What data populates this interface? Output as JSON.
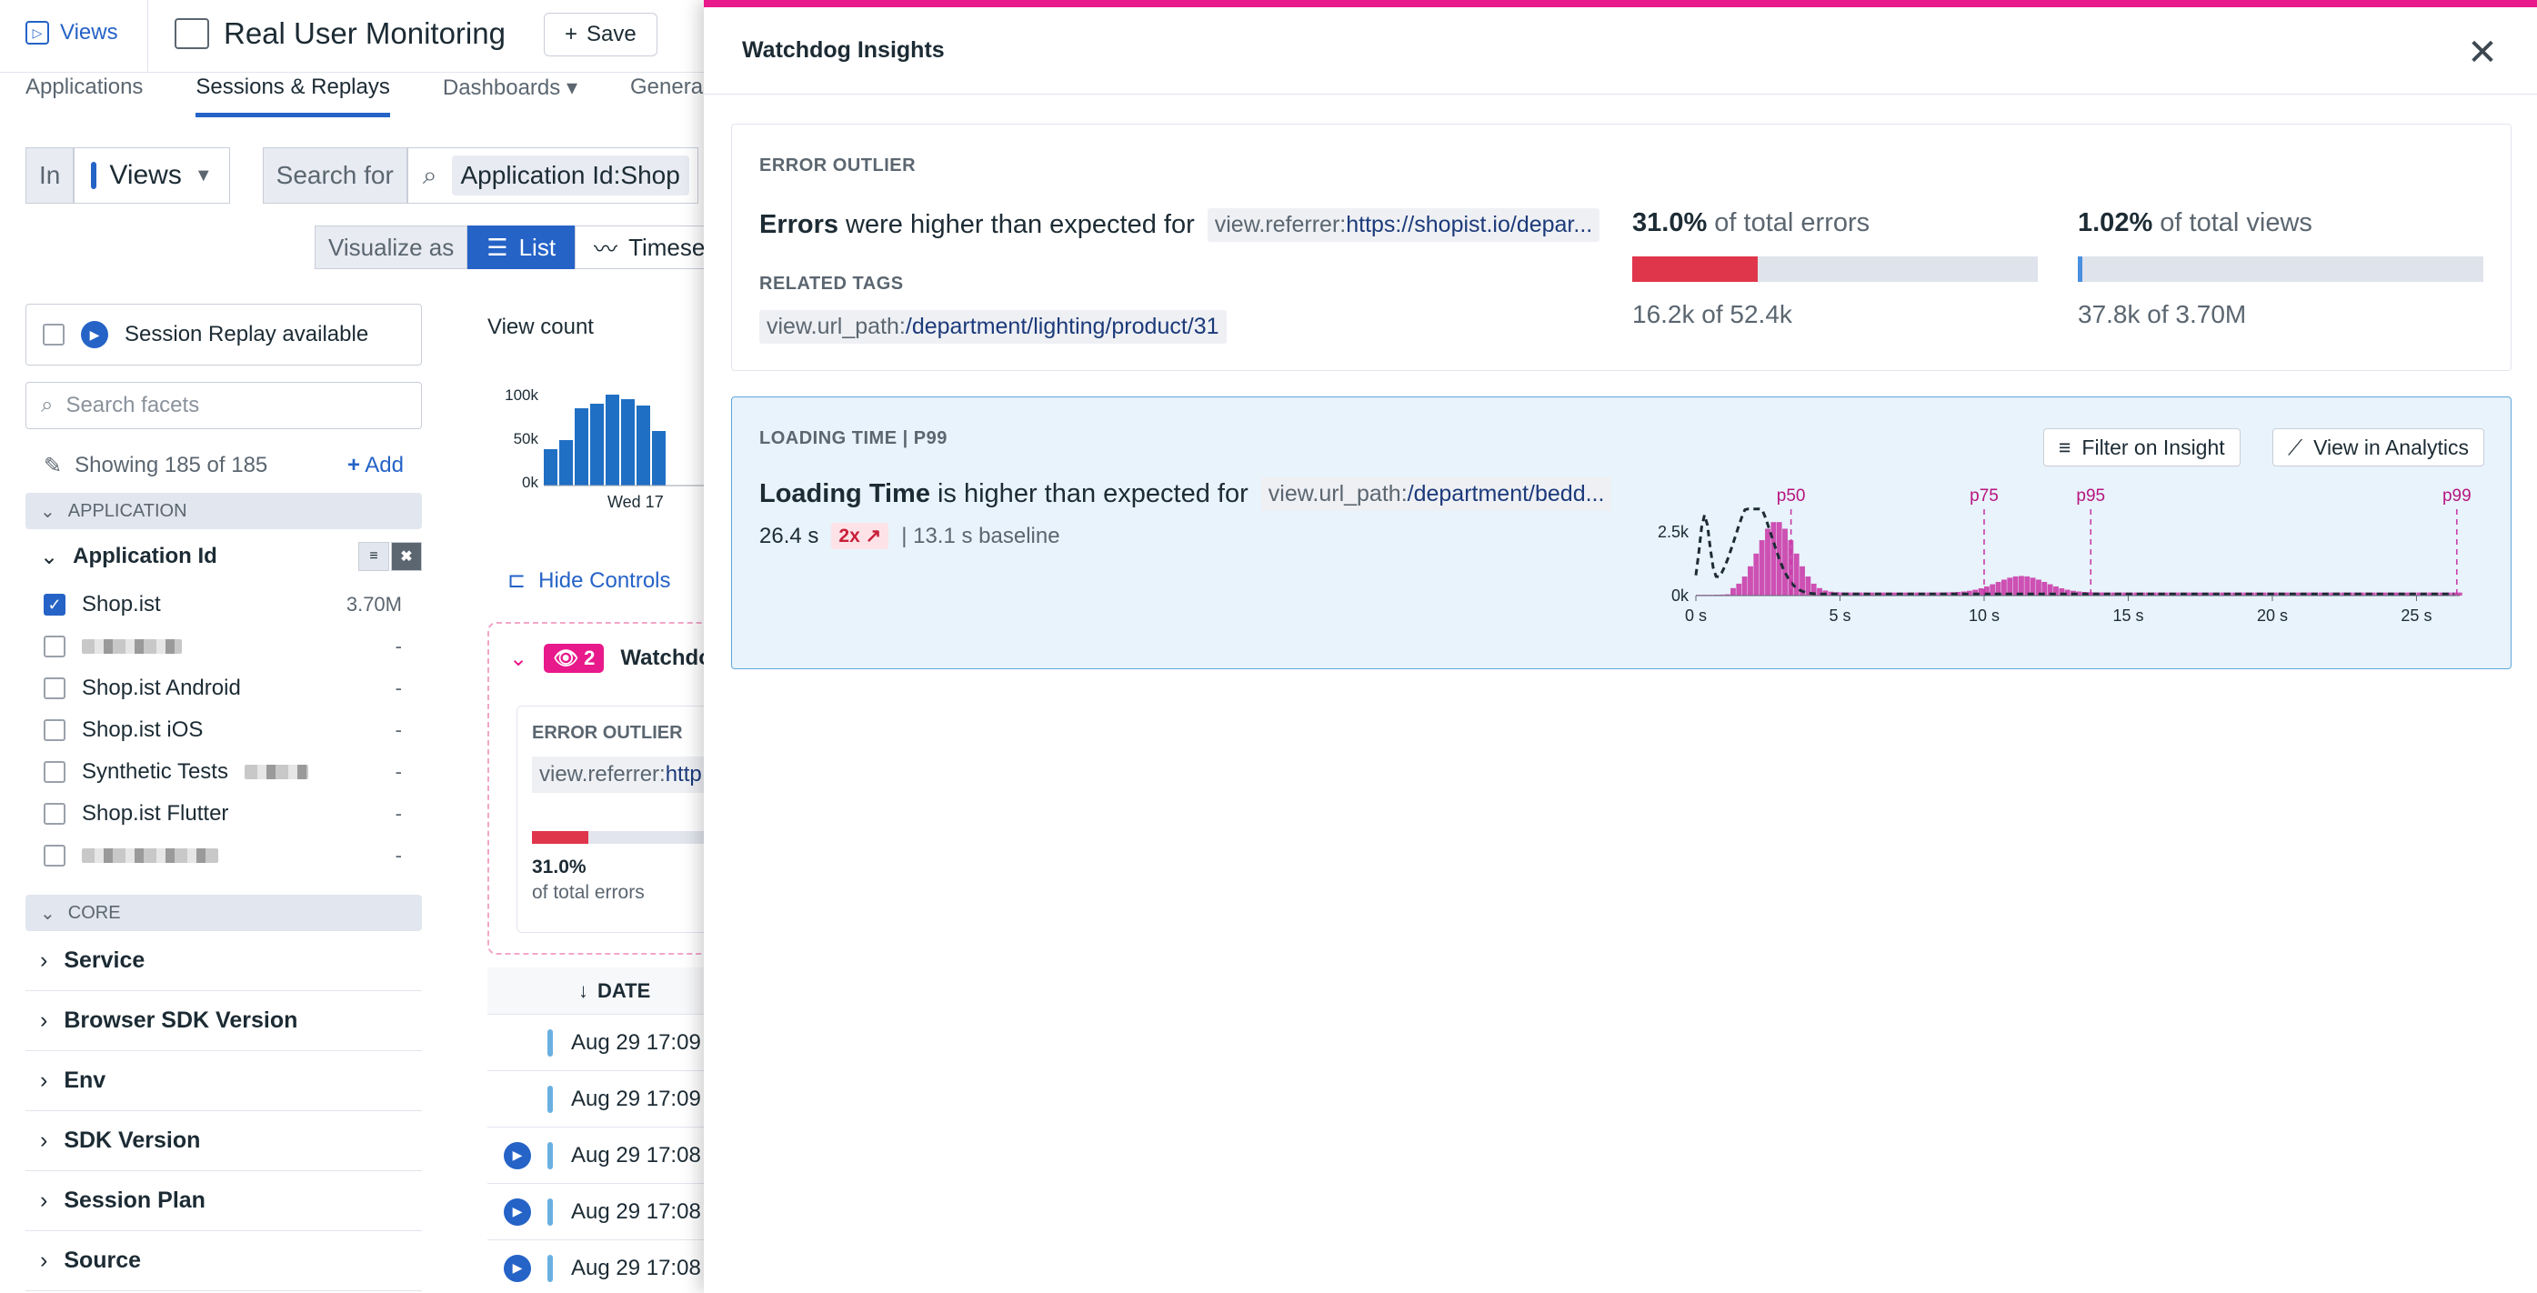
{
  "topbar": {
    "views_label": "Views",
    "page_title": "Real User Monitoring",
    "save_label": "Save"
  },
  "nav": {
    "tabs": [
      {
        "label": "Applications",
        "active": false
      },
      {
        "label": "Sessions & Replays",
        "active": true
      },
      {
        "label": "Dashboards",
        "active": false
      },
      {
        "label": "Genera",
        "active": false
      }
    ]
  },
  "query": {
    "in_label": "In",
    "scope_value": "Views",
    "search_for_label": "Search for",
    "search_value": "Application Id:Shop",
    "visualize_as_label": "Visualize as",
    "viz_list": "List",
    "viz_timeseries": "Timeseri"
  },
  "facets": {
    "session_replay_label": "Session Replay available",
    "search_placeholder": "Search facets",
    "showing_text": "Showing 185 of 185",
    "add_label": "Add",
    "application_section": "APPLICATION",
    "application_id_title": "Application Id",
    "app_items": [
      {
        "label": "Shop.ist",
        "count": "3.70M",
        "checked": true,
        "blurred": false
      },
      {
        "label": "",
        "count": "-",
        "checked": false,
        "blurred": true
      },
      {
        "label": "Shop.ist Android",
        "count": "-",
        "checked": false,
        "blurred": false
      },
      {
        "label": "Shop.ist iOS",
        "count": "-",
        "checked": false,
        "blurred": false
      },
      {
        "label": "Synthetic Tests",
        "count": "-",
        "checked": false,
        "blurred": "partial"
      },
      {
        "label": "Shop.ist Flutter",
        "count": "-",
        "checked": false,
        "blurred": false
      },
      {
        "label": "",
        "count": "-",
        "checked": false,
        "blurred": true
      }
    ],
    "core_section": "CORE",
    "core_items": [
      "Service",
      "Browser SDK Version",
      "Env",
      "SDK Version",
      "Session Plan",
      "Source"
    ]
  },
  "middle": {
    "view_count_label": "View count",
    "histogram": {
      "y_ticks": [
        "100k",
        "50k",
        "0k"
      ],
      "x_label": "Wed 17",
      "bars": [
        40,
        50,
        85,
        90,
        100,
        95,
        88,
        60
      ]
    },
    "hide_controls_label": "Hide Controls",
    "watchdog_badge": "2",
    "watchdog_title": "Watchdo",
    "card_kicker": "ERROR OUTLIER",
    "card_tag_key": "view.referrer:",
    "card_tag_value": "http",
    "card_progress": 0.31,
    "card_pct": "31.0%",
    "card_sub": "of total errors",
    "date_header": "DATE",
    "rows": [
      {
        "date": "Aug 29 17:09",
        "replay": false
      },
      {
        "date": "Aug 29 17:09",
        "replay": false
      },
      {
        "date": "Aug 29 17:08",
        "replay": true
      },
      {
        "date": "Aug 29 17:08",
        "replay": true
      },
      {
        "date": "Aug 29 17:08",
        "replay": true
      }
    ]
  },
  "overlay": {
    "title": "Watchdog Insights",
    "error_outlier": {
      "kicker": "ERROR OUTLIER",
      "headline_bold": "Errors",
      "headline_rest": "were higher than expected for",
      "tag_key": "view.referrer:",
      "tag_value": "https://shopist.io/depar...",
      "related_tags_label": "RELATED TAGS",
      "related_tag_key": "view.url_path:",
      "related_tag_value": "/department/lighting/product/31",
      "stat1_pct": "31.0%",
      "stat1_label": "of total errors",
      "stat1_fraction": 0.309,
      "stat1_detail": "16.2k of 52.4k",
      "stat2_pct": "1.02%",
      "stat2_label": "of total views",
      "stat2_fraction": 0.0102,
      "stat2_detail": "37.8k of 3.70M"
    },
    "loading_time": {
      "kicker": "LOADING TIME | P99",
      "filter_btn": "Filter on Insight",
      "analytics_btn": "View in Analytics",
      "headline_bold": "Loading Time",
      "headline_rest": "is higher than expected for",
      "tag_key": "view.url_path:",
      "tag_value": "/department/bedd...",
      "value": "26.4 s",
      "multiplier": "2x",
      "baseline": "| 13.1 s baseline",
      "chart": {
        "y_ticks": [
          "2.5k",
          "0k"
        ],
        "x_ticks": [
          "0 s",
          "5 s",
          "10 s",
          "15 s",
          "20 s",
          "25 s"
        ],
        "x_max": 26.5,
        "y_max": 3500,
        "percentiles": [
          {
            "label": "p50",
            "x": 3.3
          },
          {
            "label": "p75",
            "x": 10.0
          },
          {
            "label": "p95",
            "x": 13.7
          },
          {
            "label": "p99",
            "x": 26.4
          }
        ]
      }
    },
    "colors": {
      "accent": "#e8198b",
      "error": "#e0364b",
      "views": "#4a90e2",
      "brand": "#2563c7"
    }
  }
}
